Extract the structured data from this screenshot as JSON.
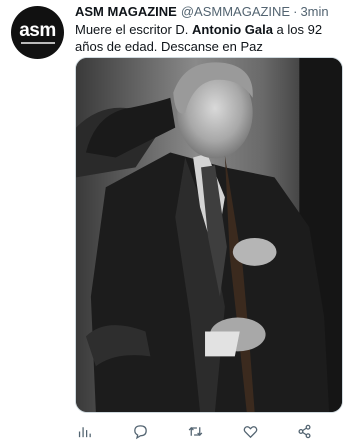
{
  "author": {
    "display_name": "ASM MAGAZINE",
    "handle": "@ASMMAGAZINE",
    "separator": "·",
    "time": "3min",
    "avatar_text": "asm"
  },
  "tweet": {
    "text_before": "Muere el escritor D. ",
    "text_bold": "Antonio Gala",
    "text_after": " a los 92 años de edad. Descanse en Paz"
  },
  "media": {
    "description_icon": "photo-image"
  },
  "actions": [
    {
      "name": "views",
      "icon": "bar-chart-icon"
    },
    {
      "name": "reply",
      "icon": "comment-icon"
    },
    {
      "name": "retweet",
      "icon": "retweet-icon"
    },
    {
      "name": "like",
      "icon": "heart-icon"
    },
    {
      "name": "share",
      "icon": "share-icon"
    }
  ],
  "colors": {
    "text_primary": "#0f1419",
    "text_secondary": "#536471",
    "icon": "#536471"
  }
}
